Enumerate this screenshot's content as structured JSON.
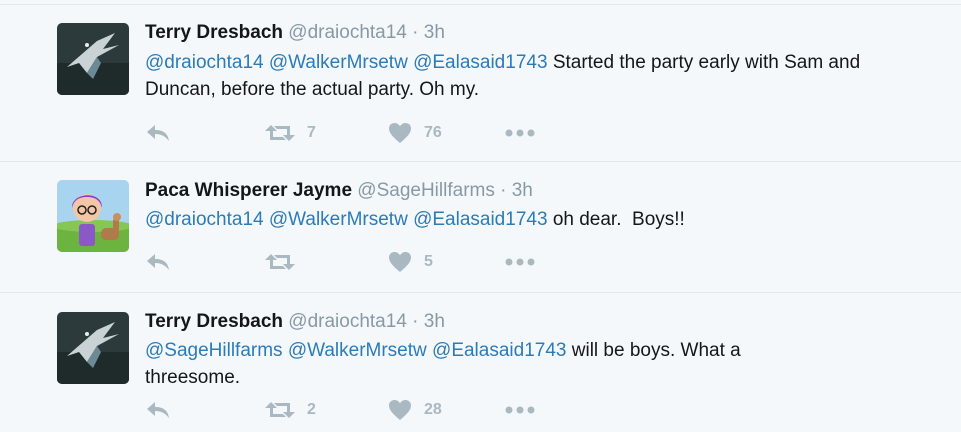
{
  "tweets": [
    {
      "name": "Terry Dresbach",
      "handle": "@draiochta14",
      "dot": "·",
      "time": "3h",
      "mentions": [
        "@draiochta14",
        "@WalkerMrsetw",
        "@Ealasaid1743"
      ],
      "text": "Started the party early with Sam and Duncan, before the actual party. Oh my.",
      "retweets": "7",
      "likes": "76",
      "avatar_icon": "swallow-bird-avatar"
    },
    {
      "name": "Paca Whisperer Jayme",
      "handle": "@SageHillfarms",
      "dot": "·",
      "time": "3h",
      "mentions": [
        "@draiochta14",
        "@WalkerMrsetw",
        "@Ealasaid1743"
      ],
      "text": "oh dear.  Boys!!",
      "retweets": "",
      "likes": "5",
      "avatar_icon": "cartoon-girl-alpaca-avatar"
    },
    {
      "name": "Terry Dresbach",
      "handle": "@draiochta14",
      "dot": "·",
      "time": "3h",
      "mentions": [
        "@SageHillfarms",
        "@WalkerMrsetw",
        "@Ealasaid1743"
      ],
      "text": "will be boys. What a threesome.",
      "retweets": "2",
      "likes": "28",
      "avatar_icon": "swallow-bird-avatar"
    }
  ],
  "colors": {
    "background": "#f5f8fa",
    "mention": "#2b7bb9",
    "meta": "#8899a6",
    "action": "#aab8c2",
    "divider": "#e1e8ed"
  },
  "icons": [
    "reply-icon",
    "retweet-icon",
    "heart-icon",
    "more-icon"
  ]
}
